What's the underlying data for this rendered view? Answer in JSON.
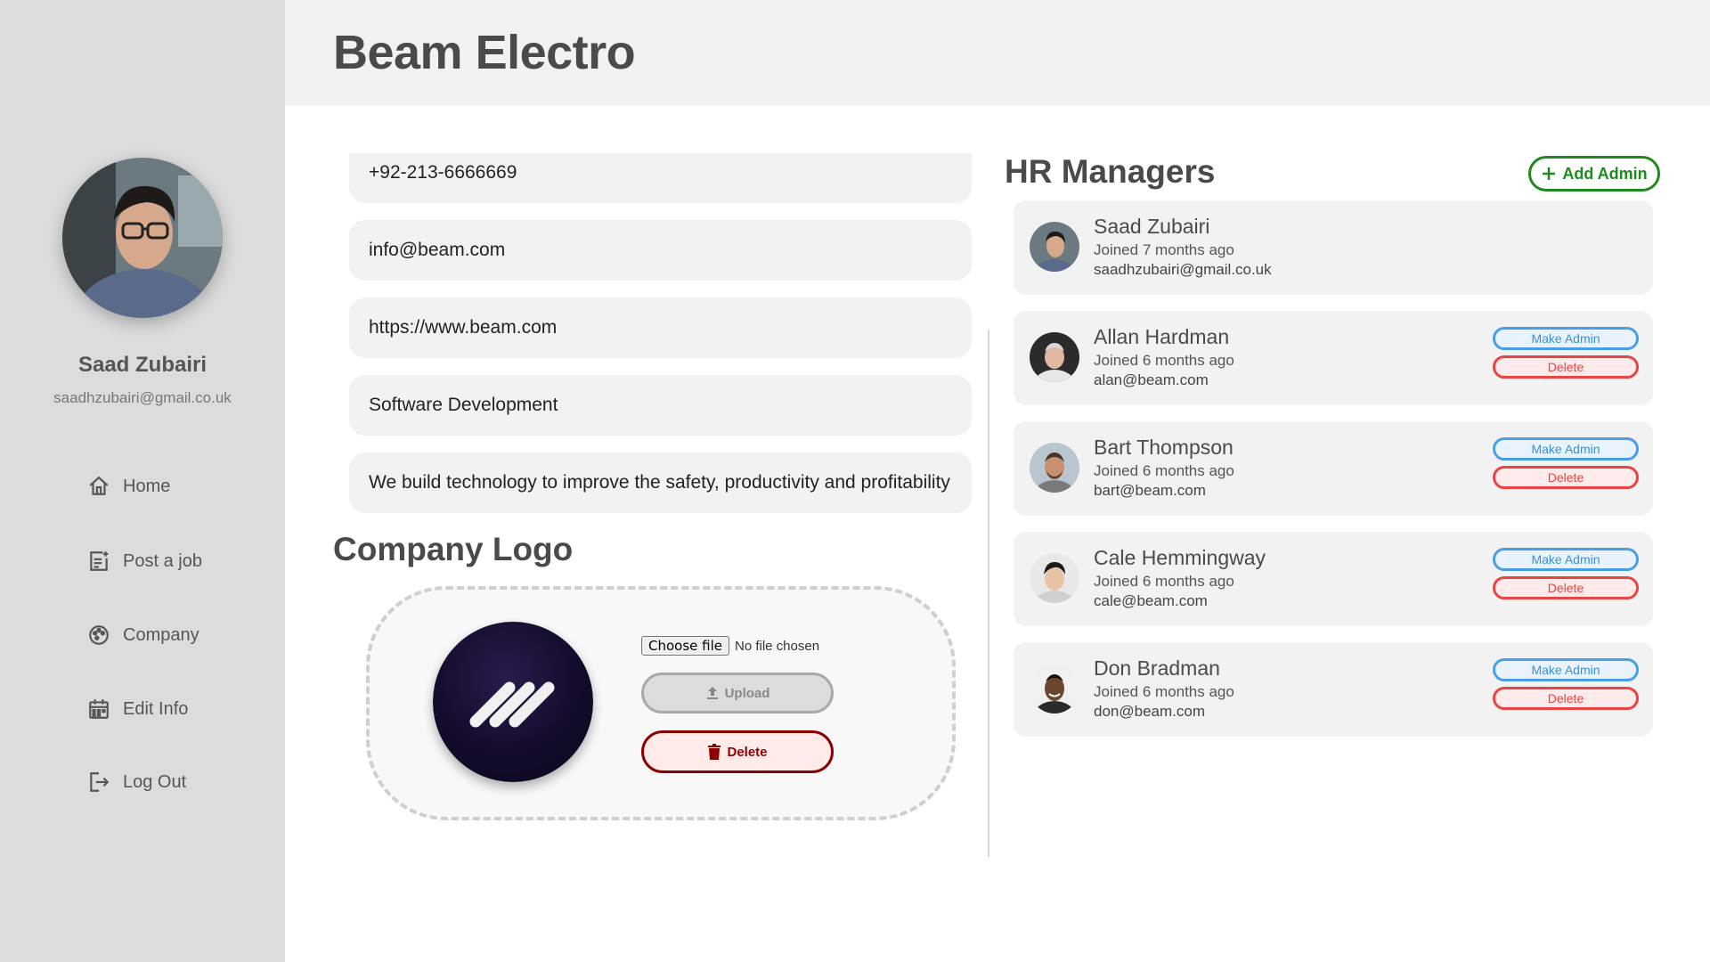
{
  "app": {
    "title": "Beam Electro"
  },
  "sidebar": {
    "user_name": "Saad Zubairi",
    "user_email": "saadhzubairi@gmail.co.uk",
    "items": [
      {
        "label": "Home",
        "icon": "home-icon"
      },
      {
        "label": "Post a job",
        "icon": "post-job-icon"
      },
      {
        "label": "Company",
        "icon": "palette-icon"
      },
      {
        "label": "Edit Info",
        "icon": "calendar-icon"
      },
      {
        "label": "Log Out",
        "icon": "logout-icon"
      }
    ]
  },
  "company": {
    "phone": "+92-213-6666669",
    "email": "info@beam.com",
    "website": "https://www.beam.com",
    "industry": "Software Development",
    "description": "We build technology to improve the safety, productivity and profitability"
  },
  "logo_section": {
    "title": "Company Logo",
    "choose_file_label": "Choose file",
    "no_file_text": "No file chosen",
    "upload_label": "Upload",
    "delete_label": "Delete"
  },
  "hr": {
    "title": "HR Managers",
    "add_admin_label": "Add Admin",
    "make_admin_label": "Make Admin",
    "delete_label": "Delete",
    "managers": [
      {
        "name": "Saad Zubairi",
        "joined": "Joined 7 months ago",
        "email": "saadhzubairi@gmail.co.uk"
      },
      {
        "name": "Allan Hardman",
        "joined": "Joined 6 months ago",
        "email": "alan@beam.com"
      },
      {
        "name": "Bart Thompson",
        "joined": "Joined 6 months ago",
        "email": "bart@beam.com"
      },
      {
        "name": "Cale Hemmingway",
        "joined": "Joined 6 months ago",
        "email": "cale@beam.com"
      },
      {
        "name": "Don Bradman",
        "joined": "Joined 6 months ago",
        "email": "don@beam.com"
      }
    ]
  },
  "colors": {
    "sidebar_bg": "#dcdcdc",
    "add_admin": "#1e8a1e",
    "make_admin": "#4a9ee8",
    "delete": "#e84444",
    "logo_delete": "#8b0000"
  }
}
